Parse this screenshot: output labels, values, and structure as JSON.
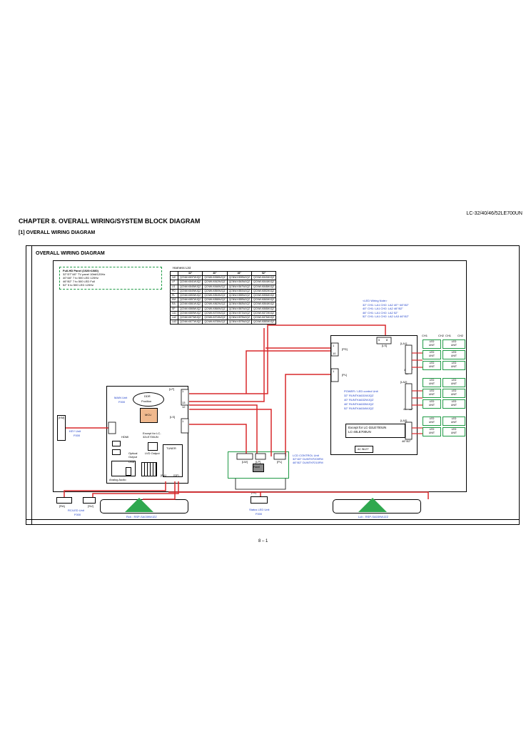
{
  "header": {
    "model": "LC-32/40/46/52LE700UN",
    "chapter": "CHAPTER 8. OVERALL WIRING/SYSTEM BLOCK DIAGRAM",
    "section": "[1] OVERALL WIRING DIAGRAM",
    "page_number": "8 – 1"
  },
  "diagram": {
    "title": "OVERALL WIRING DIAGRAM",
    "panel_note": [
      "Full-HD Panel (1920×1080)",
      "32\"/37\"/40\" TV panel 10bit/120Hz",
      "40\"/46\" 7 to 500 LED 120Hz",
      "46\"/52\" 7 to 500 LED Full",
      "52\" 5 to 500 LED 120Hz"
    ],
    "harness": {
      "title": "Harness List",
      "headers": [
        "",
        "32\"",
        "40\"",
        "46\"",
        "52\""
      ],
      "rows": [
        [
          "LW",
          "QCNW-K837WJQZ",
          "QCNW-K838WJQZ",
          "QCNW-K839WJQZ",
          "QCNW-K840WJQZ"
        ],
        [
          "LP",
          "QCNW-K841WJQZ",
          "QCNW-K842WJQZ",
          "QCNW-K843WJQZ",
          "QCNW-K844WJQZ"
        ],
        [
          "LS",
          "QCNW-K845WJQZ",
          "QCNW-K846WJQZ",
          "QCNW-K847WJQZ",
          "QCNW-K848WJQZ"
        ],
        [
          "PD",
          "QCNW-K849WJQZ",
          "QCNW-K850WJQZ",
          "QCNW-K851WJQZ",
          "QCNW-K852WJQZ"
        ],
        [
          "PL",
          "QCNW-K853WJQZ",
          "QCNW-K854WJQZ",
          "QCNW-K855WJQZ",
          "QCNW-K856WJQZ"
        ],
        [
          "KM",
          "QCNW-K857WJQZ",
          "QCNW-K858WJQZ",
          "QCNW-K859WJQZ",
          "QCNW-K860WJQZ"
        ],
        [
          "RA",
          "QCNW-K861WJQZ",
          "QCNW-K862WJQZ",
          "QCNW-K863WJQZ",
          "QCNW-K864WJQZ"
        ],
        [
          "SP",
          "QCNW-K865WJQZ",
          "QCNW-K866WJQZ",
          "QCNW-K867WJQZ",
          "QCNW-K868WJQZ"
        ],
        [
          "LA1",
          "QCNW-K869WJQZ",
          "QCNW-K870WJQZ",
          "QCNW-K871WJQZ",
          "QCNW-K872WJQZ"
        ],
        [
          "LA2",
          "QCNW-K873WJQZ",
          "QCNW-K874WJQZ",
          "QCNW-K875WJQZ",
          "QCNW-K876WJQZ"
        ],
        [
          "LA3",
          "QCNW-K877WJQZ",
          "QCNW-K878WJQZ",
          "QCNW-K879WJQZ",
          "QCNW-K880WJQZ"
        ]
      ]
    },
    "led_notes": [
      "<LED Wiring Note>",
      "32\" CH1: LA1 CH2: LA2 40\"~46\"/52\"",
      "40\" CH1: LA1 CH2: LA2 46\"/52\"",
      "46\" CH1: LA1 CH2: LA2 52\"",
      "52\" CH1: LA1 CH2: LA2 LA3 46\"/52\""
    ],
    "boards": {
      "main": {
        "title": "MAIN Unit",
        "code": "F000",
        "ddr": "DDR",
        "ddr_pos": "Position",
        "mcu": "MCU",
        "hdmi": "HDMI",
        "tuner": "TUNER",
        "optical": "Optical Output",
        "usb": "USB",
        "except_note": "Except for LC-32LE700UN",
        "lvd": "LVD Output",
        "analog": "Analog Audio",
        "antenna": "Analog Input"
      },
      "power": {
        "title": "POWER / LED control Unit",
        "lines": [
          "32\" RUNTKA631WJQZ",
          "40\" RUNTKA632WJQZ",
          "46\" RUNTKA633WJQZ",
          "52\" RUNTKA634WJQZ"
        ],
        "ac_inlet": "AC INLET"
      },
      "except": {
        "line1": "Except for LC-32LE700UN",
        "line2": "LC-40LE700UN"
      },
      "lcd_ctrl": {
        "title": "LCD CONTROL Unit",
        "lines": [
          "32\"/40\" DUNTKF209FM",
          "46\"/52\" DUNTKF210FM"
        ],
        "panel": "Panel"
      },
      "key": {
        "title": "KEY Unit",
        "code": "F000"
      },
      "rc_led": {
        "title": "RC/LED Unit",
        "code": "F000"
      },
      "status_led": {
        "title": "Status LED Unit",
        "code": "F000"
      }
    },
    "connectors": {
      "LP": "[LP]",
      "LS": "[LS]",
      "LW": "[LW]",
      "PL": "[PL]",
      "PD": "[PD]",
      "KM": "[KM]",
      "RA": "[RA]",
      "SP": "[SP]",
      "LA1": "[LA1]",
      "LA2": "[LA2]",
      "LA3": "[LA3]",
      "SL": "[SL]",
      "KM2": "[KM]",
      "SU": "[SU]"
    },
    "pins": [
      "1",
      "13",
      "12",
      "1",
      "3",
      "4",
      "1",
      "10",
      "1",
      "1",
      "5",
      "8",
      "1",
      "14",
      "13",
      "1",
      "2"
    ],
    "led_units": {
      "label1": "LED",
      "label2": "UNIT",
      "channels": [
        "CH1",
        "CH2",
        "CH1",
        "CH2"
      ]
    },
    "sizes": [
      "32\"",
      "40\"/52\"",
      "40\"~52\"",
      "46\"/52\""
    ],
    "speakers": {
      "right": "Rch : RSP-SA039WJZZ",
      "left": "Lch : RSP-SA039WJZZ"
    }
  }
}
